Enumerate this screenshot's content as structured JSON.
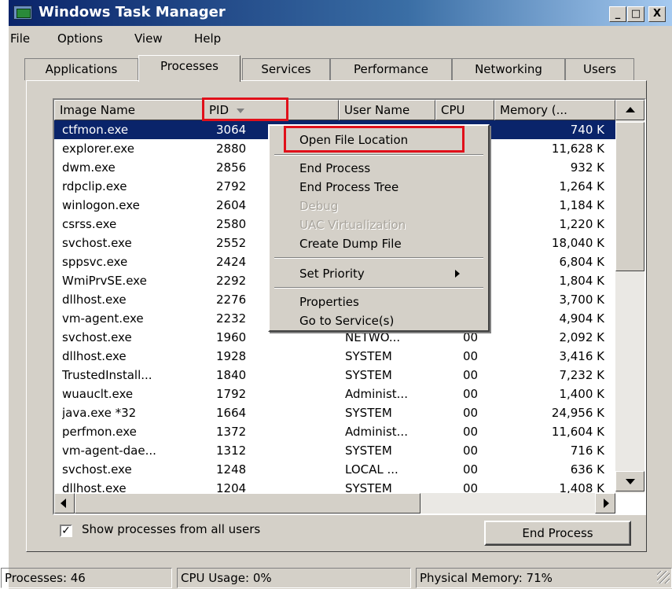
{
  "window": {
    "title": "Windows Task Manager"
  },
  "titlebar_buttons": [
    {
      "symbol": "_"
    },
    {
      "symbol": "□"
    },
    {
      "symbol": "X"
    }
  ],
  "menu": [
    "File",
    "Options",
    "View",
    "Help"
  ],
  "tabs": [
    {
      "label": "Applications",
      "active": false
    },
    {
      "label": "Processes",
      "active": true
    },
    {
      "label": "Services",
      "active": false
    },
    {
      "label": "Performance",
      "active": false
    },
    {
      "label": "Networking",
      "active": false
    },
    {
      "label": "Users",
      "active": false
    }
  ],
  "columns": {
    "name": "Image Name",
    "pid": "PID",
    "user": "User Name",
    "cpu": "CPU",
    "memory": "Memory (..."
  },
  "processes": [
    {
      "name": "ctfmon.exe",
      "pid": "3064",
      "user": "",
      "cpu": "",
      "memory": "740 K",
      "selected": true
    },
    {
      "name": "explorer.exe",
      "pid": "2880",
      "user": "",
      "cpu": "",
      "memory": "11,628 K"
    },
    {
      "name": "dwm.exe",
      "pid": "2856",
      "user": "",
      "cpu": "",
      "memory": "932 K"
    },
    {
      "name": "rdpclip.exe",
      "pid": "2792",
      "user": "",
      "cpu": "",
      "memory": "1,264 K"
    },
    {
      "name": "winlogon.exe",
      "pid": "2604",
      "user": "",
      "cpu": "",
      "memory": "1,184 K"
    },
    {
      "name": "csrss.exe",
      "pid": "2580",
      "user": "",
      "cpu": "",
      "memory": "1,220 K"
    },
    {
      "name": "svchost.exe",
      "pid": "2552",
      "user": "",
      "cpu": "",
      "memory": "18,040 K"
    },
    {
      "name": "sppsvc.exe",
      "pid": "2424",
      "user": "",
      "cpu": "",
      "memory": "6,804 K"
    },
    {
      "name": "WmiPrvSE.exe",
      "pid": "2292",
      "user": "",
      "cpu": "",
      "memory": "1,804 K"
    },
    {
      "name": "dllhost.exe",
      "pid": "2276",
      "user": "",
      "cpu": "",
      "memory": "3,700 K"
    },
    {
      "name": "vm-agent.exe",
      "pid": "2232",
      "user": "",
      "cpu": "",
      "memory": "4,904 K"
    },
    {
      "name": "svchost.exe",
      "pid": "1960",
      "user": "NETWO...",
      "cpu": "00",
      "memory": "2,092 K"
    },
    {
      "name": "dllhost.exe",
      "pid": "1928",
      "user": "SYSTEM",
      "cpu": "00",
      "memory": "3,416 K"
    },
    {
      "name": "TrustedInstall...",
      "pid": "1840",
      "user": "SYSTEM",
      "cpu": "00",
      "memory": "7,232 K"
    },
    {
      "name": "wuauclt.exe",
      "pid": "1792",
      "user": "Administ...",
      "cpu": "00",
      "memory": "1,400 K"
    },
    {
      "name": "java.exe *32",
      "pid": "1664",
      "user": "SYSTEM",
      "cpu": "00",
      "memory": "24,956 K"
    },
    {
      "name": "perfmon.exe",
      "pid": "1372",
      "user": "Administ...",
      "cpu": "00",
      "memory": "11,604 K"
    },
    {
      "name": "vm-agent-dae...",
      "pid": "1312",
      "user": "SYSTEM",
      "cpu": "00",
      "memory": "716 K"
    },
    {
      "name": "svchost.exe",
      "pid": "1248",
      "user": "LOCAL ...",
      "cpu": "00",
      "memory": "636 K"
    },
    {
      "name": "dllhost.exe",
      "pid": "1204",
      "user": "SYSTEM",
      "cpu": "00",
      "memory": "1,408 K"
    }
  ],
  "context_menu": {
    "open_file_location": "Open File Location",
    "end_process": "End Process",
    "end_process_tree": "End Process Tree",
    "debug": "Debug",
    "uac_virtualization": "UAC Virtualization",
    "create_dump_file": "Create Dump File",
    "set_priority": "Set Priority",
    "properties": "Properties",
    "go_to_services": "Go to Service(s)"
  },
  "show_all_users": {
    "label": "Show processes from all users",
    "checked": true,
    "mark": "✓"
  },
  "end_process_button": "End Process",
  "status": {
    "processes": "Processes: 46",
    "cpu": "CPU Usage: 0%",
    "memory": "Physical Memory: 71%"
  },
  "colors": {
    "selection": "#0a246a",
    "highlight_box": "#e0101a",
    "face": "#d4d0c8"
  }
}
